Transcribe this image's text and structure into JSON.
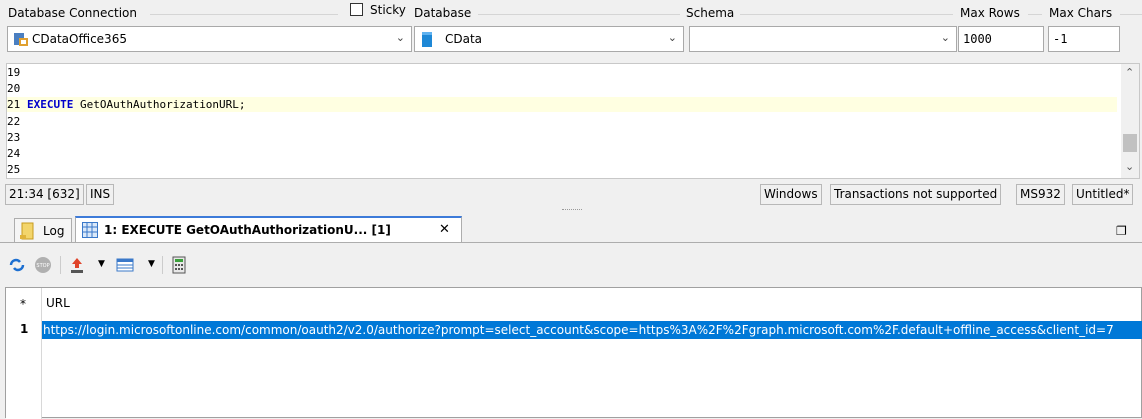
{
  "connection_bar": {
    "database_connection_label": "Database Connection",
    "sticky_label": "Sticky",
    "sticky_checked": false,
    "database_label": "Database",
    "schema_label": "Schema",
    "max_rows_label": "Max Rows",
    "max_chars_label": "Max Chars",
    "connection_value": "CDataOffice365",
    "database_value": "CData",
    "schema_value": "",
    "max_rows_value": "1000",
    "max_chars_value": "-1"
  },
  "editor": {
    "lines": [
      {
        "num": "19",
        "text": ""
      },
      {
        "num": "20",
        "text": ""
      },
      {
        "num": "21",
        "keyword": "EXECUTE",
        "text": " GetOAuthAuthorizationURL;"
      },
      {
        "num": "22",
        "text": ""
      },
      {
        "num": "23",
        "text": ""
      },
      {
        "num": "24",
        "text": ""
      },
      {
        "num": "25",
        "text": ""
      }
    ],
    "current_line_index": 2
  },
  "status_bar": {
    "position": "21:34 [632]",
    "mode": "INS",
    "line_ending": "Windows",
    "transactions": "Transactions not supported",
    "encoding": "MS932",
    "file": "Untitled*"
  },
  "tabs": {
    "log_label": "Log",
    "result_label": "1: EXECUTE GetOAuthAuthorizationU... [1]",
    "close_glyph": "✕"
  },
  "grid": {
    "header_marker": "*",
    "column": "URL",
    "row_number": "1",
    "cell_value": "https://login.microsoftonline.com/common/oauth2/v2.0/authorize?prompt=select_account&scope=https%3A%2F%2Fgraph.microsoft.com%2F.default+offline_access&client_id=7"
  },
  "colors": {
    "selection": "#0078d7",
    "keyword": "#0000cc",
    "current_line": "#ffffe1",
    "tab_accent": "#3d7bd9"
  }
}
